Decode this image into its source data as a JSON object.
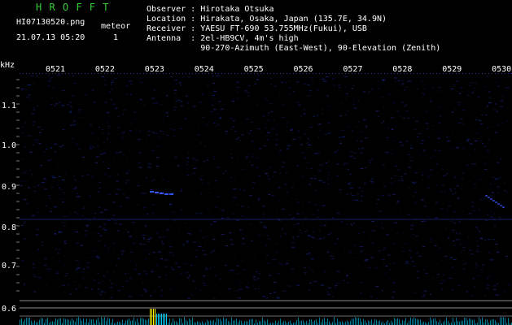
{
  "header": {
    "brand": "H R O F F T",
    "filename": "HI07130520.png",
    "datetime": "21.07.13 05:20",
    "meteor_label": "meteor",
    "meteor_count": "1",
    "observer": "Observer : Hirotaka Otsuka",
    "location": "Location : Hirakata, Osaka, Japan (135.7E, 34.9N)",
    "receiver": "Receiver : YAESU FT-690 53.755MHz(Fukui), USB",
    "antenna": "Antenna  : 2el-HB9CV, 4m's high",
    "antenna2": "           90-270-Azimuth (East-West), 90-Elevation (Zenith)"
  },
  "axis": {
    "unit": "kHz",
    "time_ticks": [
      "0521",
      "0522",
      "0523",
      "0524",
      "0525",
      "0526",
      "0527",
      "0528",
      "0529",
      "0530"
    ],
    "freq_ticks": [
      "1.1",
      "1.0",
      "0.9",
      "0.8",
      "0.7",
      "0.6"
    ]
  },
  "colors": {
    "brand": "#33cc33",
    "text": "#ffffff",
    "axis_text": "#ffffff",
    "trace": "#3355ff",
    "noise": "#1a2a9a",
    "signal_peak": "#ffff00",
    "signal_cyan": "#00d0ff"
  }
}
